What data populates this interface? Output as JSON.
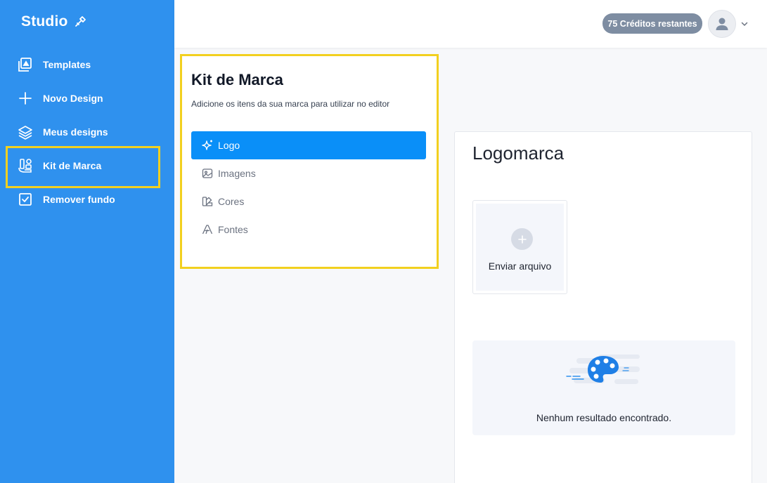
{
  "app": {
    "brand": "Studio"
  },
  "sidebar": {
    "items": [
      {
        "label": "Templates",
        "icon": "templates-icon"
      },
      {
        "label": "Novo Design",
        "icon": "plus-icon"
      },
      {
        "label": "Meus designs",
        "icon": "layers-icon"
      },
      {
        "label": "Kit de Marca",
        "icon": "brand-kit-icon"
      },
      {
        "label": "Remover fundo",
        "icon": "checkbox-icon"
      }
    ]
  },
  "header": {
    "credits": "75 Créditos restantes"
  },
  "kit": {
    "title": "Kit de Marca",
    "subtitle": "Adicione os itens da sua marca para utilizar no editor",
    "tabs": [
      {
        "label": "Logo",
        "icon": "sparkle-icon",
        "active": true
      },
      {
        "label": "Imagens",
        "icon": "image-icon",
        "active": false
      },
      {
        "label": "Cores",
        "icon": "palette-swatch-icon",
        "active": false
      },
      {
        "label": "Fontes",
        "icon": "font-icon",
        "active": false
      }
    ]
  },
  "logomarca": {
    "title": "Logomarca",
    "upload_label": "Enviar arquivo",
    "empty_text": "Nenhum resultado encontrado."
  },
  "colors": {
    "sidebar": "#2f91ee",
    "accent": "#0a8ff8",
    "highlight": "#f2d01f",
    "credits_badge": "#7e8da2"
  }
}
